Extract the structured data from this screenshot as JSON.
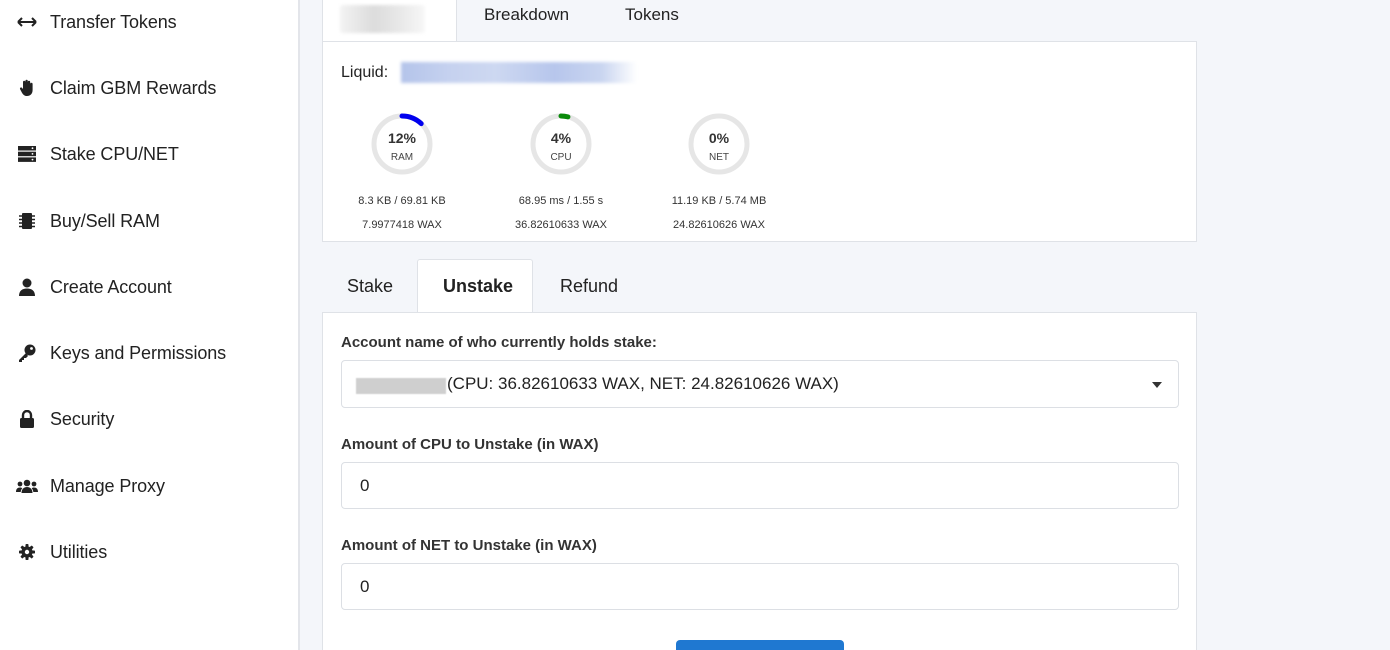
{
  "sidebar": {
    "items": [
      {
        "label": "Transfer Tokens",
        "icon": "arrows-horizontal-icon"
      },
      {
        "label": "Claim GBM Rewards",
        "icon": "hand-icon"
      },
      {
        "label": "Stake CPU/NET",
        "icon": "server-icon"
      },
      {
        "label": "Buy/Sell RAM",
        "icon": "memory-icon"
      },
      {
        "label": "Create Account",
        "icon": "user-icon"
      },
      {
        "label": "Keys and Permissions",
        "icon": "key-icon"
      },
      {
        "label": "Security",
        "icon": "lock-icon"
      },
      {
        "label": "Manage Proxy",
        "icon": "users-icon"
      },
      {
        "label": "Utilities",
        "icon": "gear-icon"
      }
    ]
  },
  "resources": {
    "tabs": [
      "Breakdown",
      "Tokens"
    ],
    "liquid_label": "Liquid:",
    "gauges": [
      {
        "percent": "12%",
        "name": "RAM",
        "usage": "8.3 KB / 69.81 KB",
        "stake": "7.9977418 WAX",
        "fraction": 0.12,
        "color": "#0000ee"
      },
      {
        "percent": "4%",
        "name": "CPU",
        "usage": "68.95 ms / 1.55 s",
        "stake": "36.82610633 WAX",
        "fraction": 0.04,
        "color": "#0a8a0a"
      },
      {
        "percent": "0%",
        "name": "NET",
        "usage": "11.19 KB / 5.74 MB",
        "stake": "24.82610626 WAX",
        "fraction": 0.0,
        "color": "#0a8a0a"
      }
    ]
  },
  "stake_tabs": {
    "items": [
      "Stake",
      "Unstake",
      "Refund"
    ],
    "active": "Unstake"
  },
  "form": {
    "holder_label": "Account name of who currently holds stake:",
    "holder_value": "(CPU: 36.82610633 WAX, NET: 24.82610626 WAX)",
    "cpu_label": "Amount of CPU to Unstake (in WAX)",
    "cpu_value": "0",
    "net_label": "Amount of NET to Unstake (in WAX)",
    "net_value": "0"
  }
}
